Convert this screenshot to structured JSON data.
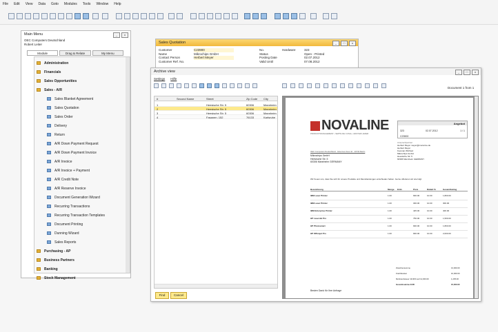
{
  "menubar": {
    "items": [
      "File",
      "Edit",
      "View",
      "Data",
      "Goto",
      "Modules",
      "Tools",
      "Window",
      "Help"
    ]
  },
  "main_menu": {
    "title": "Main Menu",
    "company": "OEC Computers Deutschland",
    "user": "Robert Leiter",
    "tabs": [
      "Module",
      "Drag & Relate",
      "My Menu"
    ],
    "sections_top": [
      "Administration",
      "Financials",
      "Sales Opportunities",
      "Sales - A/R"
    ],
    "sub_items": [
      "Sales Blanket Agreement",
      "Sales Quotation",
      "Sales Order",
      "Delivery",
      "Return",
      "A/R Down Payment Request",
      "A/R Down Payment Invoice",
      "A/R Invoice",
      "A/R Invoice + Payment",
      "A/R Credit Note",
      "A/R Reserve Invoice",
      "Document Generation Wizard",
      "Recurring Transactions",
      "Recurring Transaction Templates",
      "Document Printing",
      "Dunning Wizard",
      "Sales Reports"
    ],
    "sections_bottom": [
      "Purchasing - AP",
      "Business Partners",
      "Banking",
      "Stock Management"
    ]
  },
  "sales_quotation": {
    "title": "Sales Quotation",
    "left_labels": [
      "Customer",
      "Name",
      "Contact Person",
      "Customer Ref. No."
    ],
    "left_values": [
      "C23900",
      "Mikrochips GmbH",
      "Herbert Meyer",
      ""
    ],
    "right_labels": [
      "No.",
      "Status",
      "Posting Date",
      "Valid Until"
    ],
    "right_values": [
      "323",
      "Open - Printed",
      "02.07.2012",
      "07.08.2012"
    ],
    "series": "Hardware"
  },
  "archive": {
    "title": "Archive view",
    "menu": [
      "Settings",
      "Hilfe"
    ],
    "columns": [
      "#",
      "Second Name",
      "Street",
      "Zip Code",
      "City"
    ],
    "rows": [
      [
        "1",
        "",
        "Heesische Str. 5",
        "60306",
        "Mannheim"
      ],
      [
        "2",
        "",
        "Heesische Str. 5",
        "60306",
        "Mannheim"
      ],
      [
        "3",
        "",
        "Heesische Str. 5",
        "60306",
        "Mannheim"
      ],
      [
        "4",
        "",
        "Fasanen. 152",
        "76133",
        "Karlsruhe"
      ]
    ],
    "document_counter": "Document 1 from 1",
    "buttons": [
      "Find",
      "Cancel"
    ]
  },
  "document": {
    "logo": "NOVALINE",
    "tagline": "PRODUKTMANAGEMENT • SEPTE DE CUSAL • ESSTER LIEFER",
    "doc_type": "Angebot",
    "doc_no": "323",
    "doc_date": "02.07.2012",
    "page": "1 / 1",
    "customer_no": "C23900",
    "sender_line": "OEC Computers Deutschland · Eisernes Zoos 42 · 20734 Berlin",
    "address": [
      "Mikrochips GmbH",
      "Heesische Str. 5",
      "60306 Mannheim GERMANY"
    ],
    "contact_label": "Ansprechpartner",
    "contact_name": "Herbert Meyer",
    "contact_email": "Herbert Meyer meyer@mocarme.de",
    "sales_rep": "Kooman Winfried",
    "delivery_address": [
      "Mikrochips GmbH",
      "Heesische Str. 5",
      "60306 Mannheim GERMANY"
    ],
    "intro": "Wir freuen uns, dass Sie sich für unsere Produkte und Dienstleistungen entschieden haben. Gerne offerieren wir wie folgt:",
    "item_headers": [
      "Bezeichnung",
      "Menge",
      "Einh.",
      "Preis",
      "Rabatt %",
      "Gesamtbetrag"
    ],
    "items": [
      [
        "IBM Laser Printer",
        "1.00",
        "",
        "900.00",
        "10.00",
        "1,800.00"
      ],
      [
        "IBM Laser Printer",
        "1.00",
        "",
        "300.00",
        "10.00",
        "300.00"
      ],
      [
        "IBM Enterprise Printer",
        "1.00",
        "",
        "445.00",
        "10.00",
        "400.00"
      ],
      [
        "HP LaserJet Pro",
        "1.00",
        "",
        "750.00",
        "10.00",
        "1,500.00"
      ],
      [
        "HP Photosmart",
        "1.00",
        "",
        "900.00",
        "10.00",
        "1,800.00"
      ],
      [
        "HP Officejet Pro",
        "1.00",
        "",
        "900.00",
        "10.00",
        "2,000.00"
      ]
    ],
    "totals": [
      [
        "Zwischensumme",
        "13,000.00"
      ],
      [
        "Frachtkosten",
        "10,000.00"
      ],
      [
        "Mehrwertsteuer 19.00% auf 12,300.00",
        "1,235.00"
      ],
      [
        "Gesamtsumme EUR",
        "15,000.00"
      ]
    ],
    "closing": "Besten Dank für Ihre Anfrage"
  },
  "colors": {
    "accent": "#f5c43e",
    "selection": "#fde98c",
    "nav_blue": "#7ea7d6",
    "logo_red": "#c4312a"
  }
}
